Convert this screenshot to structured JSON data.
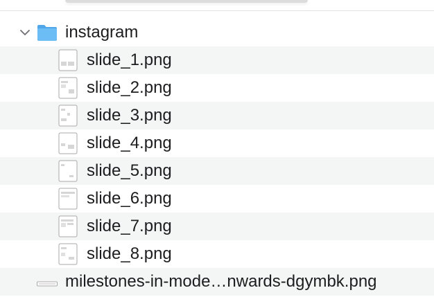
{
  "folder": {
    "name": "instagram",
    "expanded": true,
    "icon": "folder-icon",
    "color": "#5eb1f0"
  },
  "files": [
    {
      "name": "slide_1.png",
      "icon": "image-file-icon"
    },
    {
      "name": "slide_2.png",
      "icon": "image-file-icon"
    },
    {
      "name": "slide_3.png",
      "icon": "image-file-icon"
    },
    {
      "name": "slide_4.png",
      "icon": "image-file-icon"
    },
    {
      "name": "slide_5.png",
      "icon": "image-file-icon"
    },
    {
      "name": "slide_6.png",
      "icon": "image-file-icon"
    },
    {
      "name": "slide_7.png",
      "icon": "image-file-icon"
    },
    {
      "name": "slide_8.png",
      "icon": "image-file-icon"
    }
  ],
  "root_file": {
    "name": "milestones-in-mode…nwards-dgymbk.png",
    "icon": "wide-image-file-icon"
  },
  "colors": {
    "row_alt": "#f4f5f5",
    "text": "#1d1d1f"
  }
}
